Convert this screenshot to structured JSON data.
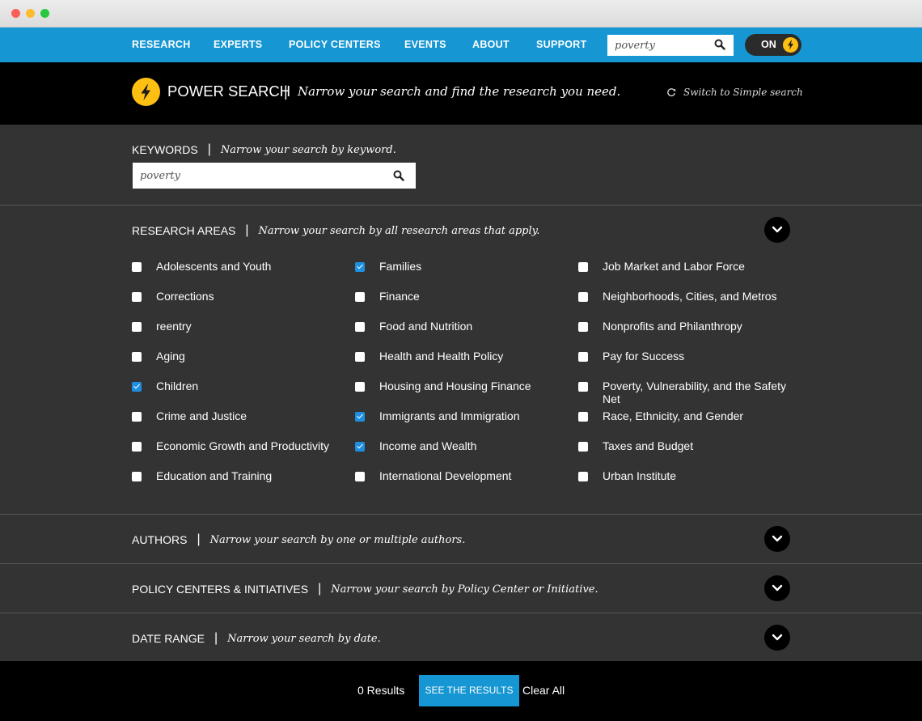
{
  "nav": {
    "items": [
      "RESEARCH",
      "EXPERTS",
      "POLICY CENTERS",
      "EVENTS",
      "ABOUT",
      "SUPPORT"
    ],
    "search_value": "poverty",
    "toggle_label": "ON"
  },
  "header": {
    "title": "POWER SEARCH",
    "separator": "|",
    "subtitle": "Narrow your search and find the research you need.",
    "switch_label": "Switch to Simple search"
  },
  "keywords": {
    "label": "KEYWORDS",
    "separator": "|",
    "hint": "Narrow your search by keyword.",
    "value": "poverty"
  },
  "research_areas": {
    "label": "RESEARCH AREAS",
    "separator": "|",
    "hint": "Narrow your search by all research areas that apply.",
    "items": [
      {
        "label": "Adolescents and Youth",
        "checked": false
      },
      {
        "label": "Corrections",
        "checked": false
      },
      {
        "label": "reentry",
        "checked": false
      },
      {
        "label": "Aging",
        "checked": false
      },
      {
        "label": "Children",
        "checked": true
      },
      {
        "label": "Crime and Justice",
        "checked": false
      },
      {
        "label": "Economic Growth and Productivity",
        "checked": false
      },
      {
        "label": "Education and Training",
        "checked": false
      },
      {
        "label": "Families",
        "checked": true
      },
      {
        "label": "Finance",
        "checked": false
      },
      {
        "label": "Food and Nutrition",
        "checked": false
      },
      {
        "label": "Health and Health Policy",
        "checked": false
      },
      {
        "label": "Housing and Housing Finance",
        "checked": false
      },
      {
        "label": "Immigrants and Immigration",
        "checked": true
      },
      {
        "label": "Income and Wealth",
        "checked": true
      },
      {
        "label": "International Development",
        "checked": false
      },
      {
        "label": "Job Market and Labor Force",
        "checked": false
      },
      {
        "label": "Neighborhoods, Cities, and Metros",
        "checked": false
      },
      {
        "label": "Nonprofits and Philanthropy",
        "checked": false
      },
      {
        "label": "Pay for Success",
        "checked": false
      },
      {
        "label": "Poverty, Vulnerability, and the Safety Net",
        "checked": false
      },
      {
        "label": "Race, Ethnicity, and Gender",
        "checked": false
      },
      {
        "label": "Taxes and Budget",
        "checked": false
      },
      {
        "label": "Urban Institute",
        "checked": false
      }
    ]
  },
  "authors": {
    "label": "AUTHORS",
    "separator": "|",
    "hint": "Narrow your search by one or multiple authors."
  },
  "policy_centers": {
    "label": "POLICY CENTERS & INITIATIVES",
    "separator": "|",
    "hint": "Narrow your search by Policy Center or Initiative."
  },
  "date_range": {
    "label": "DATE RANGE",
    "separator": "|",
    "hint": "Narrow your search by date."
  },
  "footer": {
    "results": "0 Results",
    "see_button": "SEE THE RESULTS",
    "clear_label": "Clear All"
  },
  "colors": {
    "nav_blue": "#1696d2",
    "accent_yellow": "#fdbf11",
    "checkbox_blue": "#1e8fe0"
  }
}
